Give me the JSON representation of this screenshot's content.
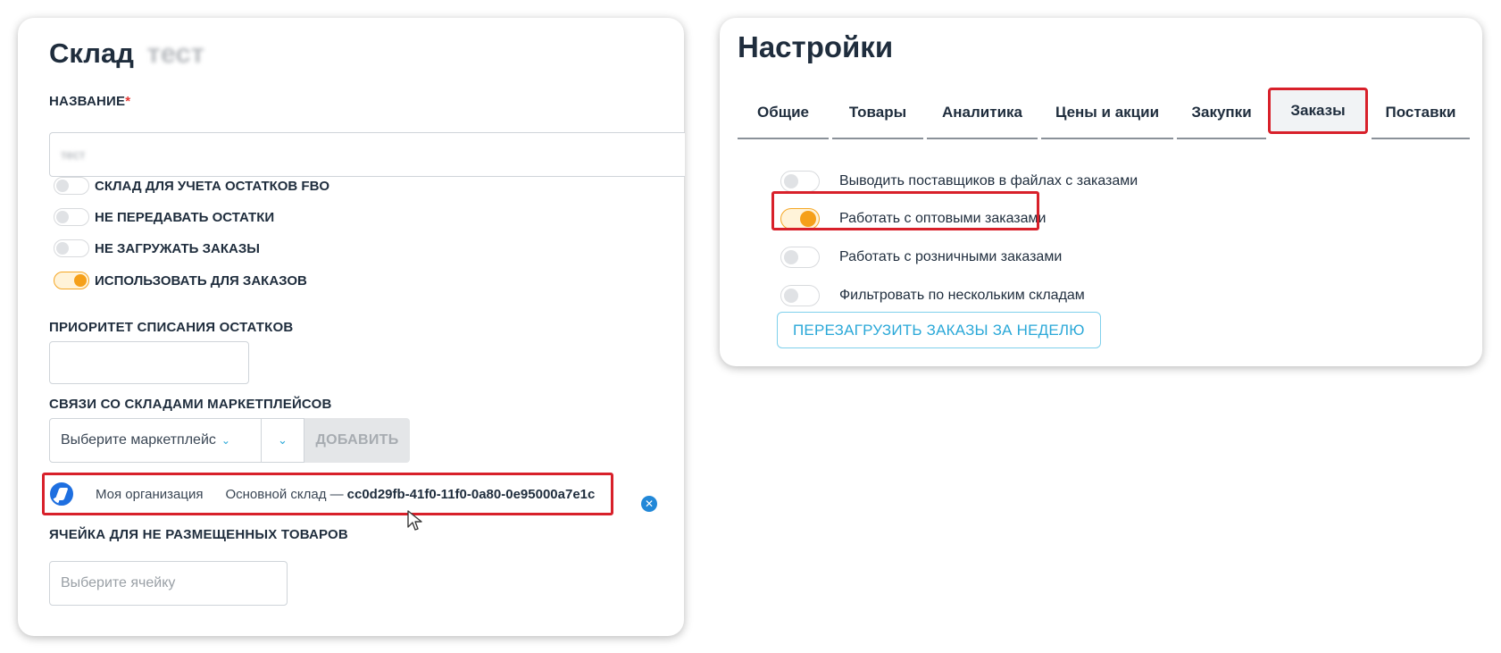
{
  "warehouse": {
    "title": "Склад",
    "title_blurred": "тест",
    "name_label": "НАЗВАНИЕ",
    "required_mark": "*",
    "name_value_blurred": "тест",
    "toggles": [
      {
        "label": "СКЛАД ДЛЯ УЧЕТА ОСТАТКОВ FBO",
        "on": false
      },
      {
        "label": "НЕ ПЕРЕДАВАТЬ ОСТАТКИ",
        "on": false
      },
      {
        "label": "НЕ ЗАГРУЖАТЬ ЗАКАЗЫ",
        "on": false
      },
      {
        "label": "ИСПОЛЬЗОВАТЬ ДЛЯ ЗАКАЗОВ",
        "on": true
      }
    ],
    "priority_label": "ПРИОРИТЕТ СПИСАНИЯ ОСТАТКОВ",
    "priority_value": "",
    "marketplace_links_label": "СВЯЗИ СО СКЛАДАМИ МАРКЕТПЛЕЙСОВ",
    "marketplace_select_placeholder": "Выберите маркетплейс",
    "add_button": "ДОБАВИТЬ",
    "link": {
      "org": "Моя организация",
      "warehouse": "Основной склад —",
      "uuid": "cc0d29fb-41f0-11f0-0a80-0e95000a7e1c"
    },
    "cell_label": "ЯЧЕЙКА ДЛЯ НЕ РАЗМЕЩЕННЫХ ТОВАРОВ",
    "cell_placeholder": "Выберите ячейку"
  },
  "settings": {
    "title": "Настройки",
    "tabs": [
      "Общие",
      "Товары",
      "Аналитика",
      "Цены и акции",
      "Закупки",
      "Заказы",
      "Поставки"
    ],
    "active_tab": "Заказы",
    "options": [
      {
        "label": "Выводить поставщиков в файлах с заказами",
        "on": false
      },
      {
        "label": "Работать с оптовыми заказами",
        "on": true
      },
      {
        "label": "Работать с розничными заказами",
        "on": false
      },
      {
        "label": "Фильтровать по нескольким складам",
        "on": false
      }
    ],
    "reload_button": "ПЕРЕЗАГРУЗИТЬ ЗАКАЗЫ ЗА НЕДЕЛЮ"
  },
  "colors": {
    "accent": "#2aa8d8",
    "toggle_on": "#f5a01a",
    "highlight": "#d8202a",
    "text": "#1f2d3d"
  }
}
